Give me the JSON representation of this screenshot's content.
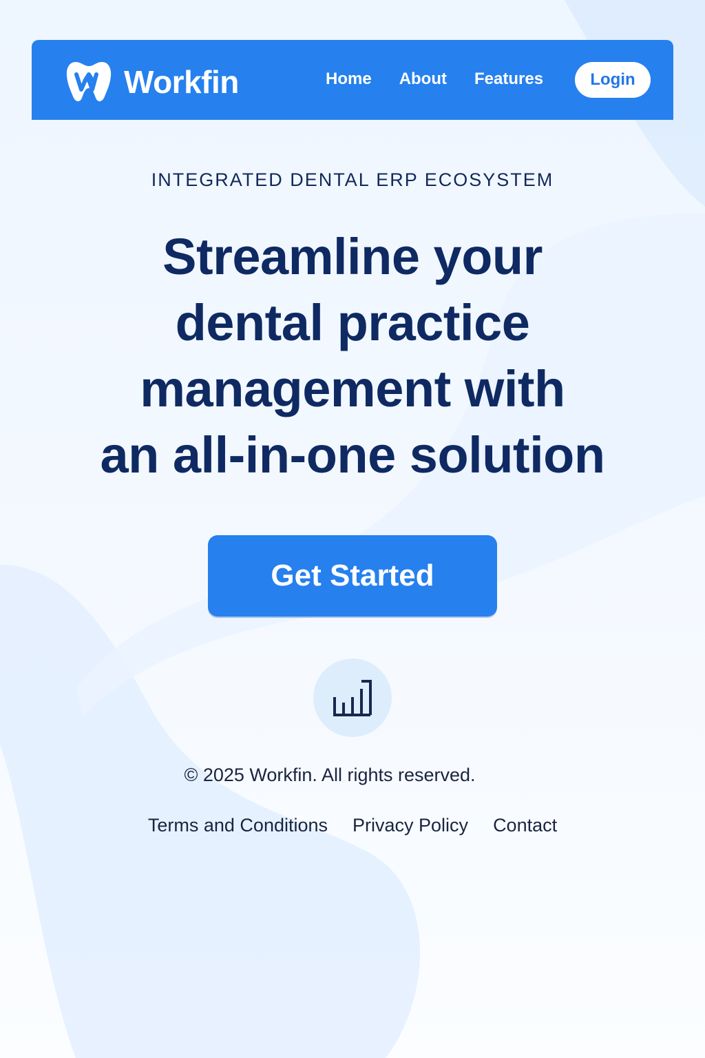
{
  "colors": {
    "primary": "#2680ee",
    "heading": "#0f2a62",
    "text": "#1a2440",
    "badge_bg": "#deedfb"
  },
  "header": {
    "brand_name": "Workfin",
    "logo_icon": "tooth-w-logo-icon",
    "nav": [
      {
        "label": "Home"
      },
      {
        "label": "About"
      },
      {
        "label": "Features"
      }
    ],
    "login_label": "Login"
  },
  "hero": {
    "eyebrow": "INTEGRATED DENTAL ERP ECOSYSTEM",
    "headline_lines": [
      "Streamline your",
      "dental practice",
      "management with",
      "an all-in-one solution"
    ],
    "cta_label": "Get Started",
    "feature_icon": "bar-chart-icon"
  },
  "footer": {
    "copyright": "© 2025 Workfin. All rights reserved.",
    "links": [
      {
        "label": "Terms and Conditions"
      },
      {
        "label": "Privacy Policy"
      },
      {
        "label": "Contact"
      }
    ]
  }
}
